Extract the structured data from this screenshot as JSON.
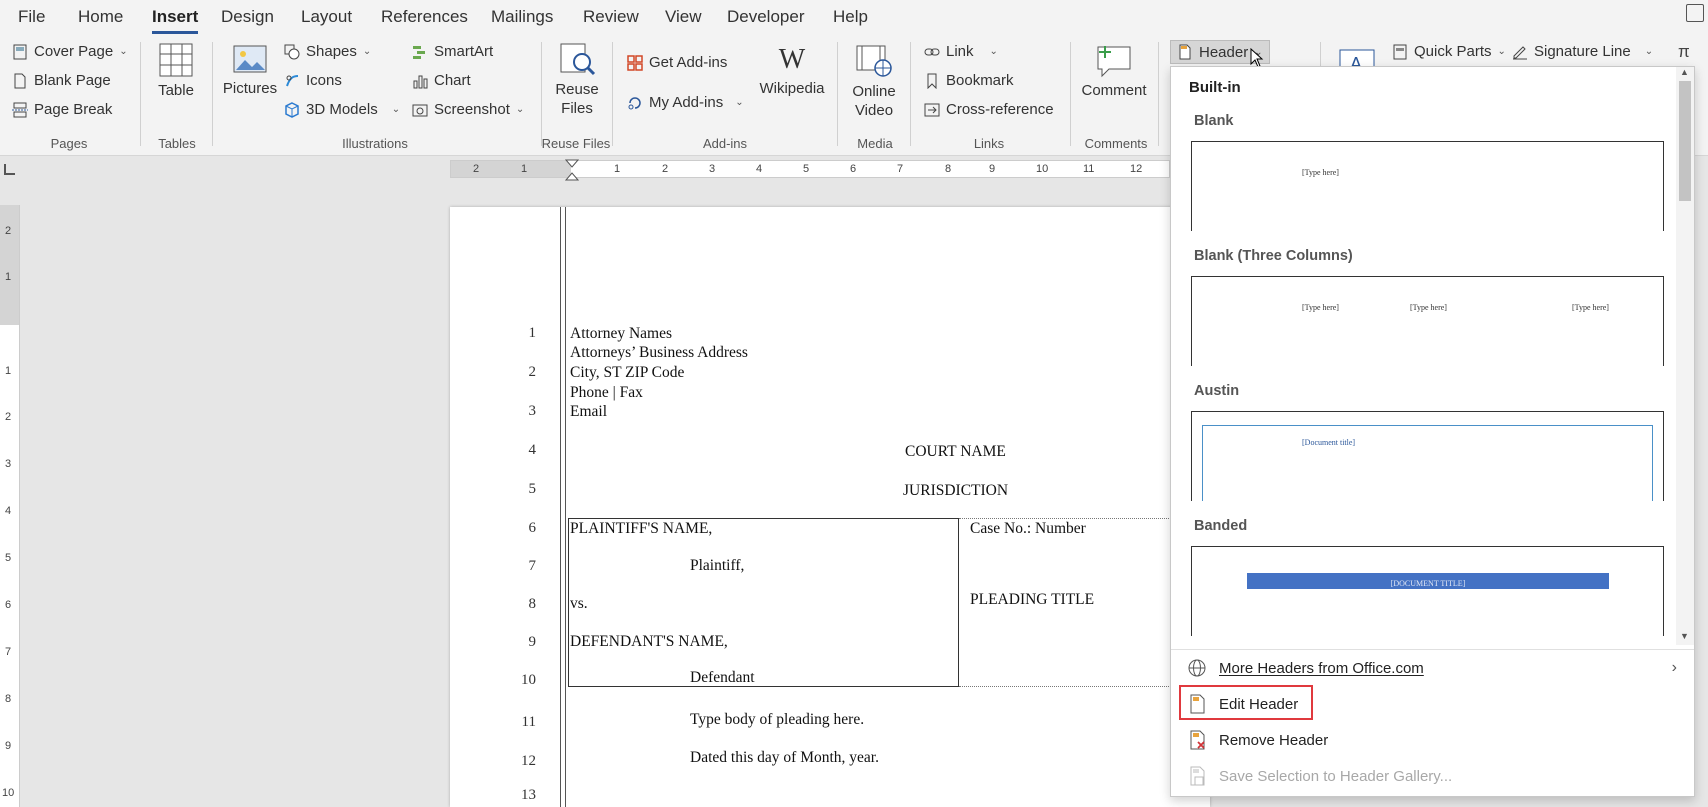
{
  "menu": {
    "tabs": [
      "File",
      "Home",
      "Insert",
      "Design",
      "Layout",
      "References",
      "Mailings",
      "Review",
      "View",
      "Developer",
      "Help"
    ],
    "active": "Insert"
  },
  "ribbon": {
    "pages": {
      "cover_page": "Cover Page",
      "blank_page": "Blank Page",
      "page_break": "Page Break",
      "group": "Pages"
    },
    "tables": {
      "table": "Table",
      "group": "Tables"
    },
    "illustrations": {
      "pictures": "Pictures",
      "shapes": "Shapes",
      "icons": "Icons",
      "models": "3D Models",
      "smartart": "SmartArt",
      "chart": "Chart",
      "screenshot": "Screenshot",
      "group": "Illustrations"
    },
    "reuse": {
      "reuse_files": "Reuse Files",
      "group": "Reuse Files"
    },
    "addins": {
      "get_addins": "Get Add-ins",
      "my_addins": "My Add-ins",
      "wikipedia": "Wikipedia",
      "group": "Add-ins"
    },
    "media": {
      "online_video": "Online Video",
      "group": "Media"
    },
    "links": {
      "link": "Link",
      "bookmark": "Bookmark",
      "cross_reference": "Cross-reference",
      "group": "Links"
    },
    "comments": {
      "comment": "Comment",
      "group": "Comments"
    },
    "header_footer": {
      "header": "Header"
    },
    "text": {
      "quick_parts": "Quick Parts",
      "signature_line": "Signature Line"
    }
  },
  "document": {
    "attorney_lines": [
      "Attorney Names",
      "Attorneys’ Business Address",
      "City, ST ZIP Code",
      "Phone | Fax",
      "Email"
    ],
    "court_name": "COURT NAME",
    "jurisdiction": "JURISDICTION",
    "plaintiff_name": "PLAINTIFF'S NAME,",
    "plaintiff": "Plaintiff,",
    "vs": "vs.",
    "defendant_name": "DEFENDANT'S NAME,",
    "defendant": "Defendant",
    "case_no": "Case No.: Number",
    "pleading_title": "PLEADING TITLE",
    "body": "Type body of pleading here.",
    "dated": "Dated this day of Month, year.",
    "line_numbers": [
      "1",
      "2",
      "3",
      "4",
      "5",
      "6",
      "7",
      "8",
      "9",
      "10",
      "11",
      "12",
      "13"
    ]
  },
  "dropdown": {
    "section": "Built-in",
    "blank": {
      "title": "Blank",
      "placeholder": "[Type here]"
    },
    "blank3": {
      "title": "Blank (Three Columns)",
      "placeholder": "[Type here]"
    },
    "austin": {
      "title": "Austin",
      "placeholder": "[Document title]"
    },
    "banded": {
      "title": "Banded",
      "placeholder": "[DOCUMENT TITLE]"
    },
    "more_headers": "More Headers from Office.com",
    "edit_header": "Edit Header",
    "remove_header": "Remove Header",
    "save_selection": "Save Selection to Header Gallery..."
  },
  "ruler": {
    "h_ticks": [
      "2",
      "1",
      "1",
      "2",
      "3",
      "4",
      "5",
      "6",
      "7",
      "8",
      "9",
      "10",
      "11",
      "12"
    ],
    "v_ticks": [
      "2",
      "1",
      "1",
      "2",
      "3",
      "4",
      "5",
      "6",
      "7",
      "8",
      "9",
      "10"
    ]
  },
  "colors": {
    "accent": "#2b579a",
    "banded": "#4472c4",
    "highlight": "#e0393e"
  }
}
